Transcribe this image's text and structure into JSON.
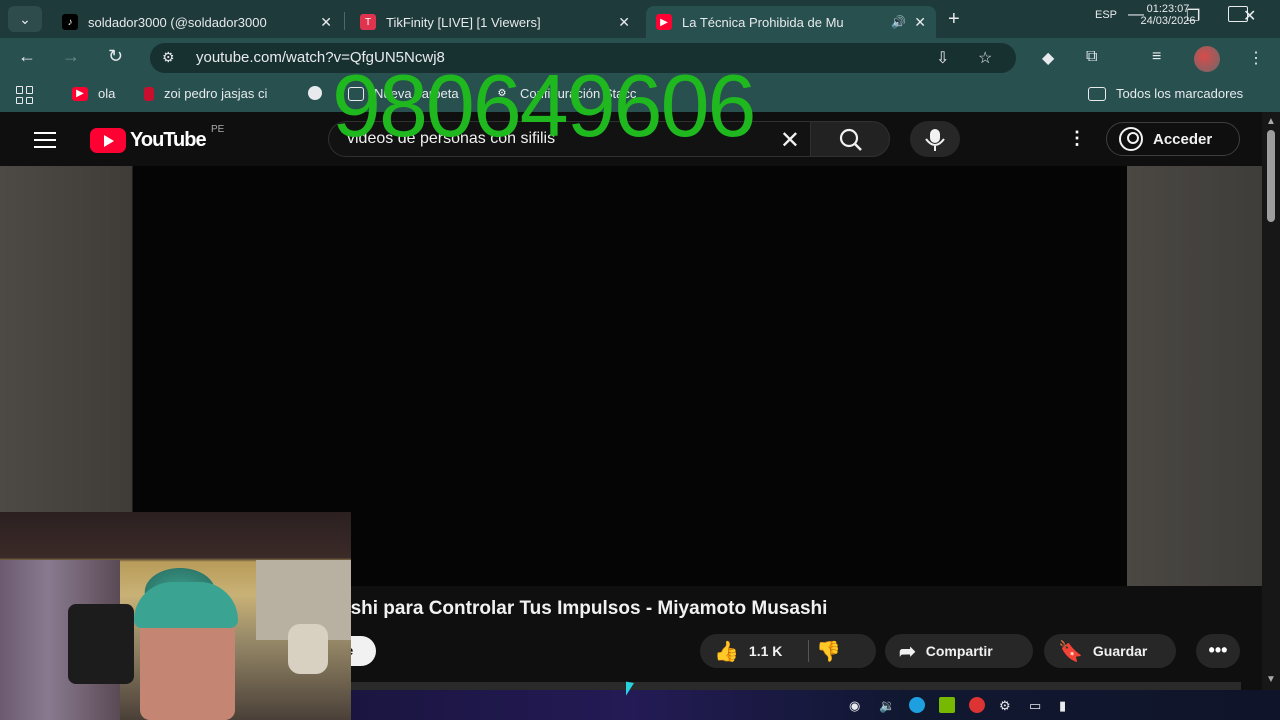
{
  "browser": {
    "tabs": [
      {
        "title": "soldador3000 (@soldador3000",
        "favicon": "tiktok-icon",
        "active": false
      },
      {
        "title": "TikFinity [LIVE] [1 Viewers]",
        "favicon": "tikfinity-icon",
        "active": false
      },
      {
        "title": "La Técnica Prohibida de Mu",
        "favicon": "youtube-icon",
        "active": true,
        "audio": true
      }
    ],
    "url": "youtube.com/watch?v=QfgUN5Ncwj8",
    "bookmarks": [
      {
        "label": "ola",
        "icon": "youtube-icon"
      },
      {
        "label": "zoi pedro jasjas ci",
        "icon": "bookmark-icon"
      },
      {
        "label": "",
        "icon": "circle-icon"
      },
      {
        "label": "Nueva carpeta",
        "icon": "folder-icon"
      },
      {
        "label": "Configuración Stacc",
        "icon": "gear-icon"
      }
    ],
    "all_bookmarks": "Todos los marcadores"
  },
  "overlay": {
    "number": "980649606",
    "color": "#1fb81f"
  },
  "youtube": {
    "logo": "YouTube",
    "region": "PE",
    "search_query": "videos de personas con sifilis",
    "signin": "Acceder",
    "video_title": "ashi para Controlar Tus Impulsos - Miyamoto Musashi",
    "subscribe_fragment": "e",
    "likes": "1.1 K",
    "share": "Compartir",
    "save": "Guardar"
  },
  "taskbar": {
    "language": "ESP",
    "time": "01:23:07",
    "date": "24/03/2026"
  },
  "colors": {
    "accent": "#27504f",
    "youtube_red": "#ff0033"
  }
}
